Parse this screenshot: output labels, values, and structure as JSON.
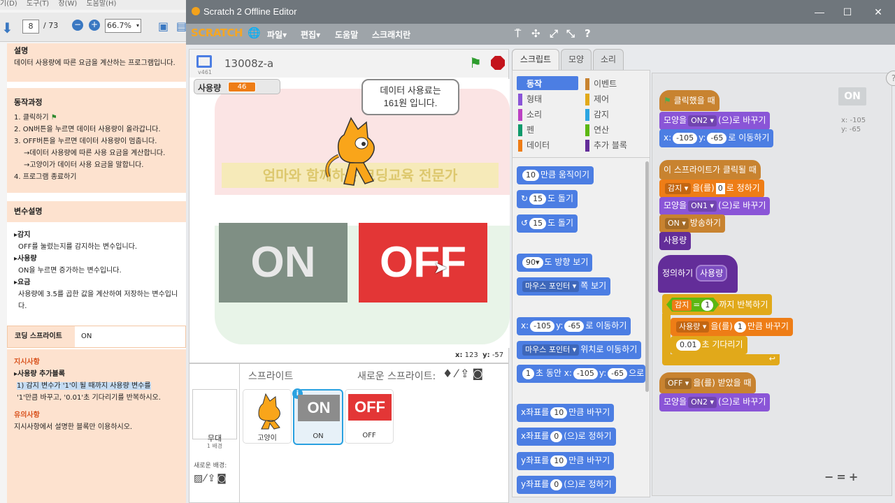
{
  "pdf": {
    "menu": [
      "기(D)",
      "도구(T)",
      "창(W)",
      "도움말(H)"
    ],
    "page_current": "8",
    "page_total": "/ 73",
    "zoom": "66.7%",
    "section1_title": "설명",
    "section1_body": "데이터 사용량에 따른 요금을 계산하는 프로그램입니다.",
    "section2_title": "동작과정",
    "steps": [
      "1.  클릭하기",
      "2.  ON버튼을 누르면 데이터 사용량이 올라갑니다.",
      "3.  OFF버튼을 누르면 데이터 사용량이 멈춥니다.",
      "→데이터 사용량에 따른 사용 요금을 계산합니다.",
      "→고양이가 데이터 사용 요금을 말합니다.",
      "4.  프로그램 종료하기"
    ],
    "vars_title": "변수설명",
    "vars": [
      {
        "name": "▸감지",
        "desc": "OFF를 눌렀는지를 감지하는 변수입니다."
      },
      {
        "name": "▸사용량",
        "desc": "ON을 누르면 증가하는 변수입니다."
      },
      {
        "name": "▸요금",
        "desc": "사용량에 3.5를 곱한 값을 계산하여 저장하는 변수입니다."
      }
    ],
    "coding_sprite_label": "코딩 스프라이트",
    "coding_sprite_value": "ON",
    "instr_title": "지시사항",
    "instr_sub": "▸사용량 추가블록",
    "instr_body_1": "1) 감지  변수가  '1'이  될  때까지  사용량  변수를",
    "instr_body_2": "'1'만큼 바꾸고, '0.01'초 기다리기를 반복하시오.",
    "caution_title": "유의사항",
    "caution_body": "지시사항에서 설명한 블록만 이용하시오."
  },
  "window": {
    "title": "Scratch 2 Offline Editor",
    "min": "—",
    "max": "☐",
    "close": "✕"
  },
  "menubar": {
    "logo": "SCRATCH",
    "file": "파일▾",
    "edit": "편집▾",
    "help": "도움말",
    "about": "스크래치란"
  },
  "stage": {
    "project_name": "13008z-a",
    "version": "v461",
    "var_label": "사용량",
    "var_value": "46",
    "speech": "데이터 사용료는\n161원 입니다.",
    "on_label": "ON",
    "off_label": "OFF",
    "watermark_text": "엄마와 함께하는 코딩교육 전문가",
    "coord_x_label": "x:",
    "coord_x": "123",
    "coord_y_label": "y:",
    "coord_y": "-57"
  },
  "sprites": {
    "header": "스프라이트",
    "new_sprite": "새로운 스프라이트:",
    "stage_label": "무대",
    "stage_sub": "1 배경",
    "new_bg": "새로운 배경:",
    "items": [
      {
        "name": "고양이"
      },
      {
        "name": "ON",
        "thumb": "ON"
      },
      {
        "name": "OFF",
        "thumb": "OFF"
      }
    ]
  },
  "tabs": [
    "스크립트",
    "모양",
    "소리"
  ],
  "categories": [
    {
      "label": "동작",
      "color": "#4c7ee3"
    },
    {
      "label": "이벤트",
      "color": "#c88330"
    },
    {
      "label": "형태",
      "color": "#8a55d7"
    },
    {
      "label": "제어",
      "color": "#e1a91a"
    },
    {
      "label": "소리",
      "color": "#bb42c3"
    },
    {
      "label": "감지",
      "color": "#2ca5e2"
    },
    {
      "label": "펜",
      "color": "#0e9a6c"
    },
    {
      "label": "연산",
      "color": "#5cb712"
    },
    {
      "label": "데이터",
      "color": "#ee7d16"
    },
    {
      "label": "추가 블록",
      "color": "#632d99"
    }
  ],
  "palette": {
    "move_n": "10",
    "move_t": "만큼 움직이기",
    "turn_r_n": "15",
    "turn_t": "도 돌기",
    "turn_l_n": "15",
    "point_n": "90▾",
    "point_t": "도 방향 보기",
    "towards_dd": "마우스 포인터 ▾",
    "towards_t": "쪽 보기",
    "goto_x_l": "x:",
    "goto_x": "-105",
    "goto_y_l": "y:",
    "goto_y": "-65",
    "goto_t": "로 이동하기",
    "goto2_dd": "마우스 포인터 ▾",
    "goto2_t": "위치로 이동하기",
    "glide_n": "1",
    "glide_t1": "초 동안 x:",
    "glide_x": "-105",
    "glide_y_l": "y:",
    "glide_y": "-65",
    "glide_t2": "으로",
    "cx_t1": "x좌표를",
    "cx_n": "10",
    "cx_t2": "만큼 바꾸기",
    "sx_t1": "x좌표를",
    "sx_n": "0",
    "sx_t2": "(으)로 정하기",
    "cy_t1": "y좌표를",
    "cy_n": "10",
    "cy_t2": "만큼 바꾸기",
    "sy_t1": "y좌표를",
    "sy_n": "0",
    "sy_t2": "(으)로 정하기"
  },
  "script": {
    "sprite_name": "ON",
    "x_label": "x: -105",
    "y_label": "y: -65",
    "s1_hat": "클릭했을 때",
    "s1_look_t1": "모양을",
    "s1_look_dd": "ON2 ▾",
    "s1_look_t2": "(으)로 바꾸기",
    "s1_go_xl": "x:",
    "s1_go_x": "-105",
    "s1_go_yl": "y:",
    "s1_go_y": "-65",
    "s1_go_t": "로 이동하기",
    "s2_hat": "이 스프라이트가 클릭될 때",
    "s2_set_dd": "감지 ▾",
    "s2_set_t1": "을(를)",
    "s2_set_v": "0",
    "s2_set_t2": "로 정하기",
    "s2_look_t1": "모양을",
    "s2_look_dd": "ON1 ▾",
    "s2_look_t2": "(으)로 바꾸기",
    "s2_bc_dd": "ON ▾",
    "s2_bc_t": "방송하기",
    "s2_call": "사용량",
    "s3_define": "정의하기",
    "s3_name": "사용량",
    "s3_repeat_var": "감지",
    "s3_repeat_eq": "=",
    "s3_repeat_v": "1",
    "s3_repeat_t": "까지 반복하기",
    "s3_change_dd": "사용량 ▾",
    "s3_change_t1": "을(를)",
    "s3_change_v": "1",
    "s3_change_t2": "만큼 바꾸기",
    "s3_wait_v": "0.01",
    "s3_wait_t": "초 기다리기",
    "s4_recv_dd": "OFF ▾",
    "s4_recv_t": "을(를) 받았을 때",
    "s4_look_t1": "모양을",
    "s4_look_dd": "ON2 ▾",
    "s4_look_t2": "(으)로 바꾸기",
    "zoom_out": "−",
    "zoom_reset": "=",
    "zoom_in": "+"
  }
}
